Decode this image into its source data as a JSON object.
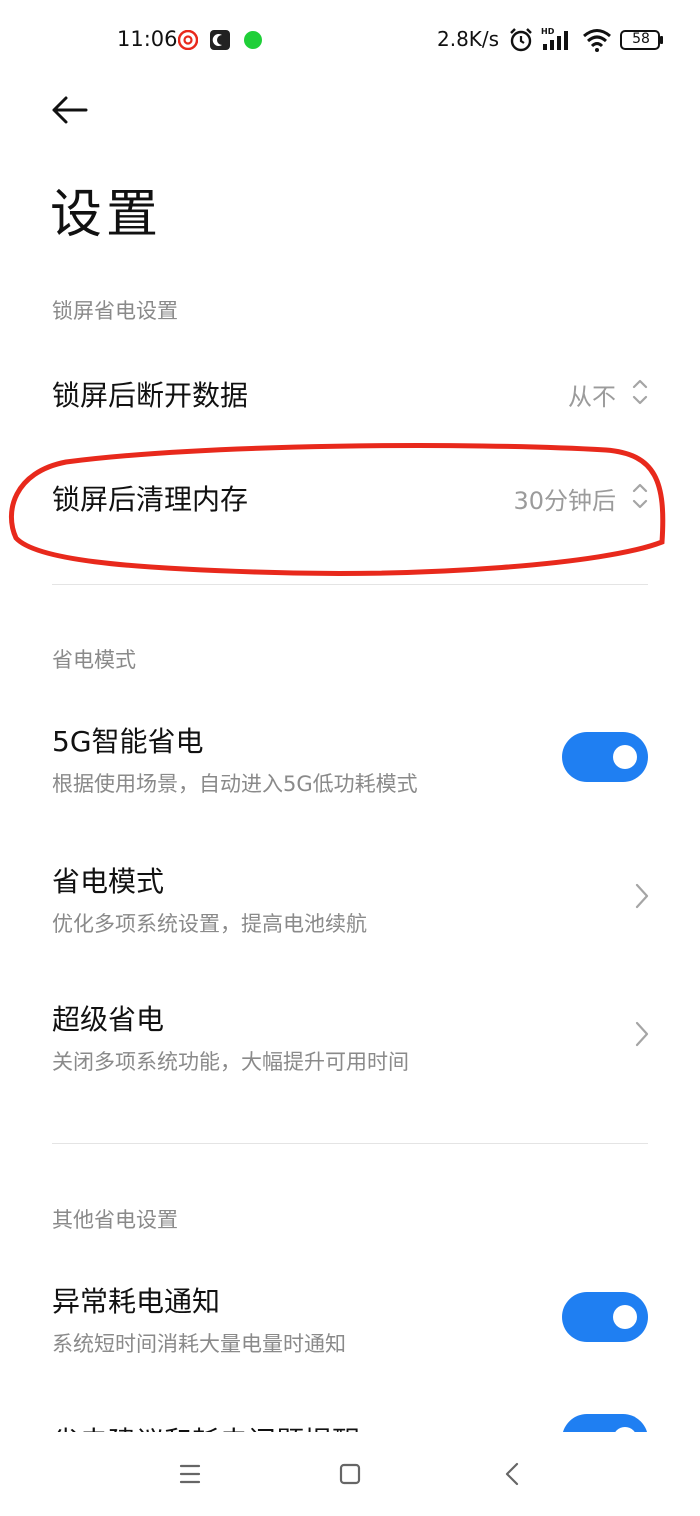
{
  "status_bar": {
    "time": "11:06",
    "net_speed": "2.8K/s",
    "battery": "58",
    "icons": [
      "netease-music-icon",
      "moon-app-icon",
      "green-dot-icon",
      "alarm-icon",
      "hd-signal-icon",
      "wifi-icon",
      "battery-icon"
    ]
  },
  "header": {
    "back_icon": "arrow-left-icon",
    "title": "设置"
  },
  "sections": {
    "lock_screen": {
      "header": "锁屏省电设置",
      "disconnect_data": {
        "title": "锁屏后断开数据",
        "value": "从不"
      },
      "clear_memory": {
        "title": "锁屏后清理内存",
        "value": "30分钟后"
      }
    },
    "power_mode": {
      "header": "省电模式",
      "smart_5g": {
        "title": "5G智能省电",
        "subtitle": "根据使用场景，自动进入5G低功耗模式",
        "enabled": true
      },
      "power_saving": {
        "title": "省电模式",
        "subtitle": "优化多项系统设置，提高电池续航"
      },
      "ultra_saving": {
        "title": "超级省电",
        "subtitle": "关闭多项系统功能，大幅提升可用时间"
      }
    },
    "other": {
      "header": "其他省电设置",
      "abnormal_notify": {
        "title": "异常耗电通知",
        "subtitle": "系统短时间消耗大量电量时通知",
        "enabled": true
      },
      "suggestion": {
        "title": "省电建议和耗电问题提醒",
        "enabled": true
      }
    }
  },
  "colors": {
    "accent": "#1f7ff2",
    "annotation": "#e8291c",
    "secondary_text": "#8a8a8a"
  },
  "nav_bar": {
    "icons": [
      "menu-icon",
      "home-square-icon",
      "back-chevron-icon"
    ]
  }
}
